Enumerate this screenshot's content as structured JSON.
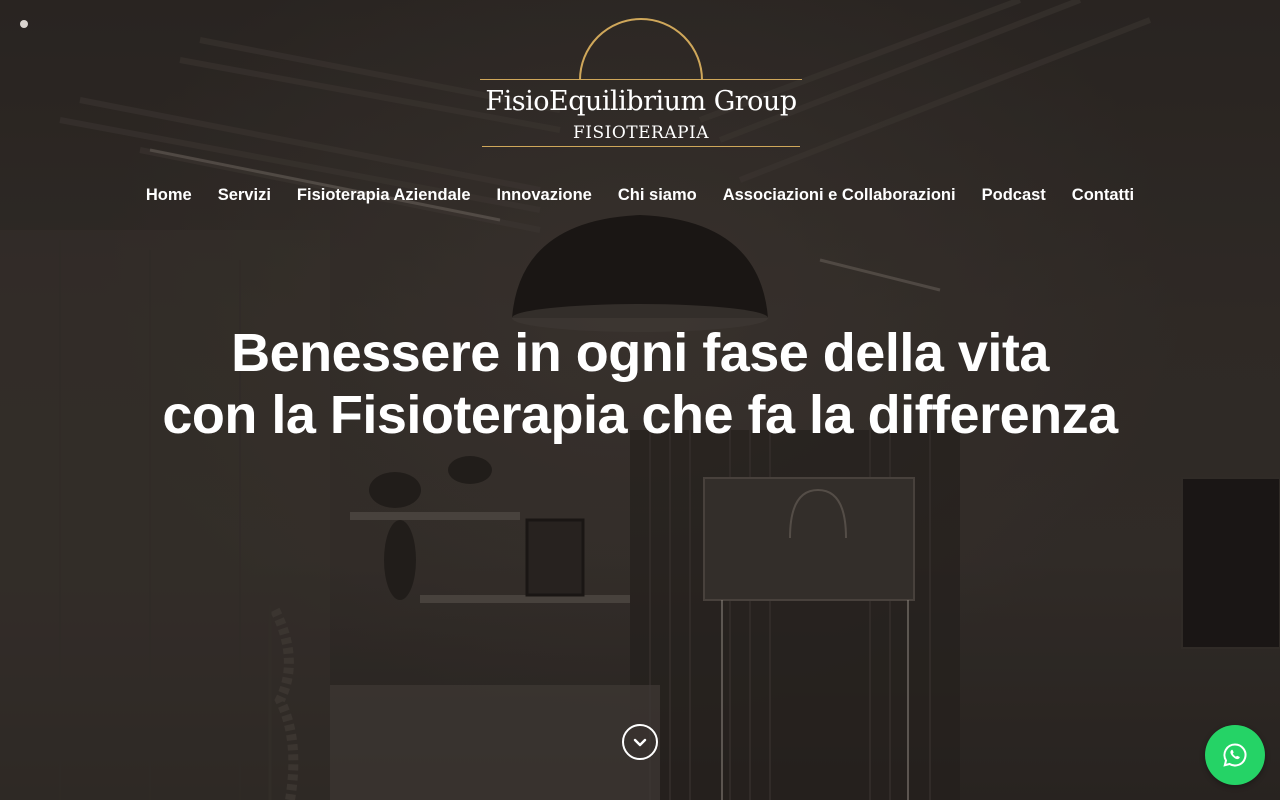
{
  "brand": {
    "name": "FisioEquilibrium Group",
    "tagline": "FISIOTERAPIA",
    "accent_color": "#cfa75a"
  },
  "nav": {
    "items": [
      {
        "label": "Home"
      },
      {
        "label": "Servizi"
      },
      {
        "label": "Fisioterapia Aziendale"
      },
      {
        "label": "Innovazione"
      },
      {
        "label": "Chi siamo"
      },
      {
        "label": "Associazioni e Collaborazioni"
      },
      {
        "label": "Podcast"
      },
      {
        "label": "Contatti"
      }
    ]
  },
  "hero": {
    "headline_line1": "Benessere in ogni fase della vita",
    "headline_line2": "con la Fisioterapia che fa la differenza",
    "scroll_icon": "chevron-down-icon"
  },
  "whatsapp": {
    "icon": "whatsapp-icon",
    "color": "#25d366"
  }
}
